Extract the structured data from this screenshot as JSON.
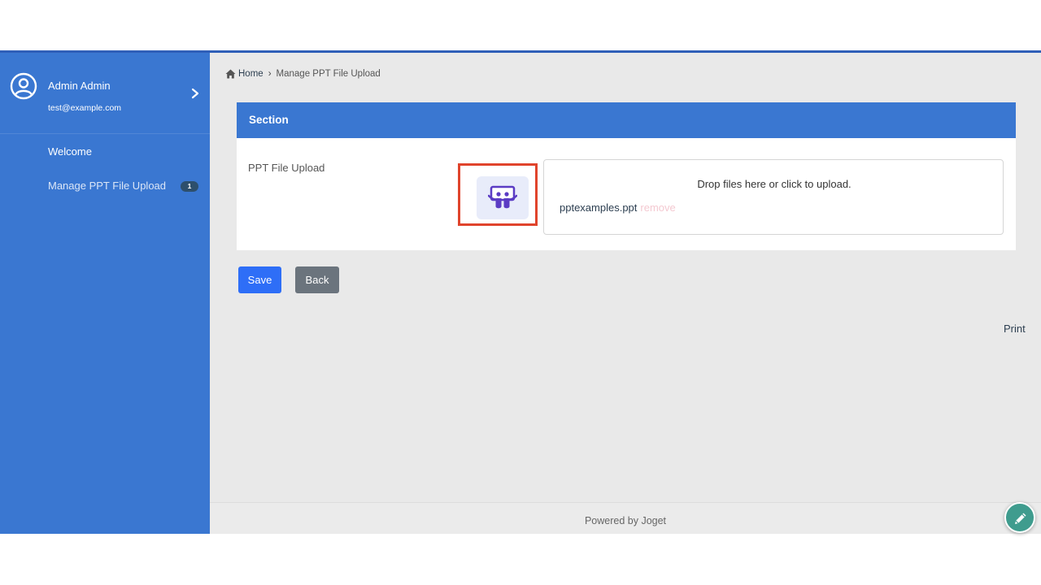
{
  "sidebar": {
    "user_name": "Admin Admin",
    "user_email": "test@example.com",
    "items": [
      {
        "label": "Welcome"
      },
      {
        "label": "Manage PPT File Upload",
        "badge": "1"
      }
    ]
  },
  "breadcrumb": {
    "home": "Home",
    "separator": "›",
    "current": "Manage PPT File Upload"
  },
  "form": {
    "section_title": "Section",
    "field_label": "PPT File Upload",
    "dropzone_text": "Drop files here or click to upload.",
    "file_name": "pptexamples.ppt",
    "remove_label": "remove"
  },
  "buttons": {
    "save": "Save",
    "back": "Back"
  },
  "print_label": "Print",
  "footer_text": "Powered by Joget",
  "colors": {
    "sidebar": "#3a77d1",
    "header_accent": "#3a77d1",
    "save_button": "#2e6ef7",
    "back_button": "#6b747d",
    "highlight_box": "#e0442c",
    "fab": "#3f9c8e"
  },
  "icons": {
    "avatar": "user-circle-icon",
    "profile_chevron": "chevron-right-icon",
    "home": "home-icon",
    "file_thumbnail": "slideshare-icon",
    "fab": "pencil-icon"
  }
}
